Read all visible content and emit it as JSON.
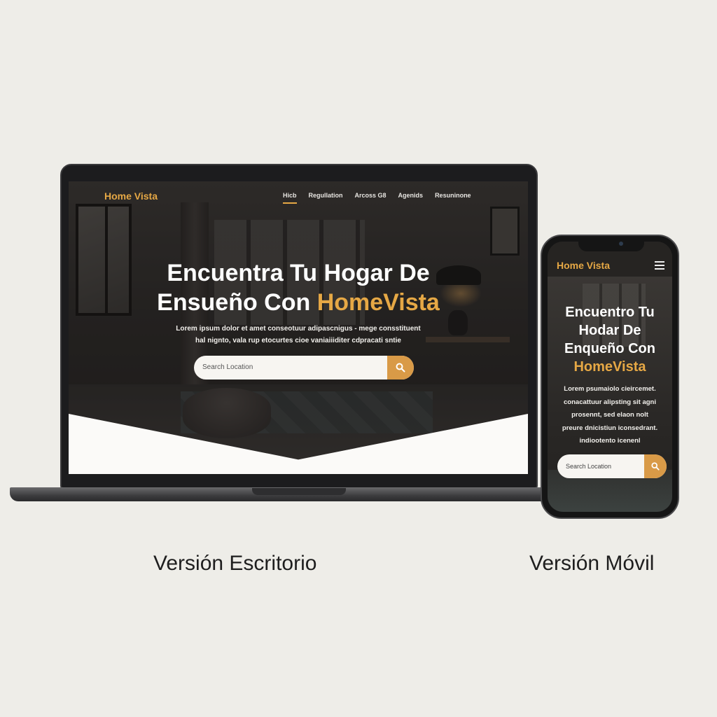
{
  "desktop": {
    "logo": "Home Vista",
    "nav": [
      {
        "label": "Hicb",
        "active": true
      },
      {
        "label": "Regullation",
        "active": false
      },
      {
        "label": "Arcoss G8",
        "active": false
      },
      {
        "label": "Agenids",
        "active": false
      },
      {
        "label": "Resuninone",
        "active": false
      }
    ],
    "hero": {
      "title_line1": "Encuentra Tu Hogar De",
      "title_line2_prefix": "Ensueño Con ",
      "title_accent": "HomeVista",
      "subtitle_line1": "Lorem ipsum dolor et amet conseotuur adipascnigus - mege consstituent",
      "subtitle_line2": "hal nignto, vala rup etocurtes cioe vaniaiiiditer cdpracati sntie"
    },
    "search": {
      "placeholder": "Search Location"
    }
  },
  "mobile": {
    "logo": "Home Vista",
    "hero": {
      "title_line1": "Encuentro Tu",
      "title_line2": "Hodar De",
      "title_line3": "Enqueño Con",
      "title_accent": "HomeVista",
      "subtitle_lines": [
        "Lorem psumaiolo cieircemet.",
        "conacattuur alipsting sit agni",
        "prosennt, sed elaon nolt",
        "preure dnicistiun iconsedrant.",
        "indiootento icenenl"
      ]
    },
    "search": {
      "placeholder": "Search Location"
    }
  },
  "captions": {
    "desktop": "Versión Escritorio",
    "mobile": "Versión Móvil"
  },
  "colors": {
    "accent": "#e6a845",
    "search_button": "#d99a47",
    "background": "#eeede8"
  }
}
